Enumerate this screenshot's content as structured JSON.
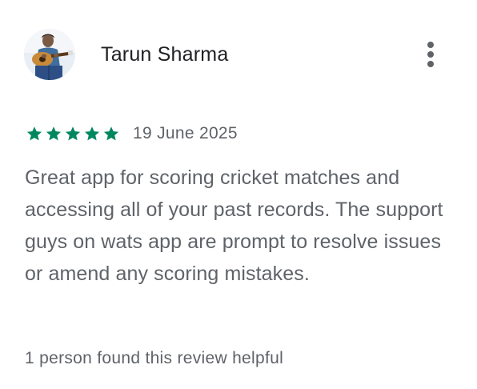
{
  "review": {
    "reviewer_name": "Tarun Sharma",
    "avatar_icon": "user-photo-with-guitar",
    "more_icon": "more-vert-icon",
    "rating": 5,
    "rating_max": 5,
    "star_color": "#01875f",
    "date": "19 June 2025",
    "text": "Great app for scoring cricket matches and accessing all of your past records. The support guys on wats app are prompt to resolve issues or amend any scoring mistakes.",
    "helpful": "1 person found this review helpful"
  }
}
